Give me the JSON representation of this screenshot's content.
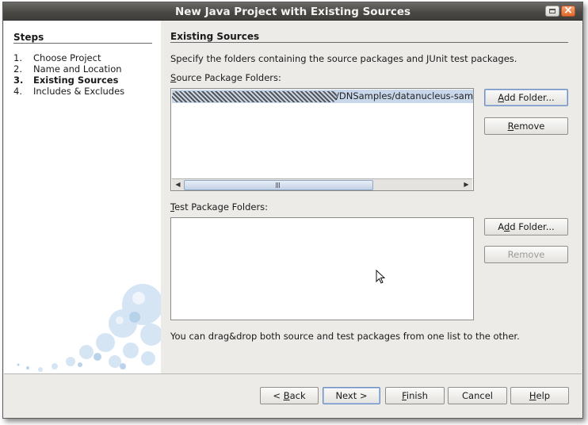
{
  "window": {
    "title": "New Java Project with Existing Sources",
    "maximize_icon": "maximize-icon",
    "close_icon": "close-icon"
  },
  "steps": {
    "title": "Steps",
    "items": [
      {
        "num": "1.",
        "label": "Choose Project",
        "active": false
      },
      {
        "num": "2.",
        "label": "Name and Location",
        "active": false
      },
      {
        "num": "3.",
        "label": "Existing Sources",
        "active": true
      },
      {
        "num": "4.",
        "label": "Includes & Excludes",
        "active": false
      }
    ]
  },
  "main": {
    "title": "Existing Sources",
    "description": "Specify the folders containing the source packages and JUnit test packages.",
    "source_label": "Source Package Folders:",
    "source_label_mnemonic": "S",
    "source_label_rest": "ource Package Folders:",
    "source_items": [
      "/DNSamples/datanucleus-samp"
    ],
    "test_label_mnemonic": "T",
    "test_label_rest": "est Package Folders:",
    "hint": "You can drag&drop both source and test packages from one list to the other."
  },
  "buttons": {
    "add_folder_src": {
      "mn": "A",
      "rest": "dd Folder..."
    },
    "remove_src": {
      "pre": "",
      "mn": "R",
      "rest": "emove"
    },
    "add_folder_test": {
      "pre": "A",
      "mn": "d",
      "rest": "d Folder..."
    },
    "remove_test": "Remove"
  },
  "footer": {
    "back": {
      "pre": "< ",
      "mn": "B",
      "rest": "ack"
    },
    "next": "Next >",
    "finish": {
      "mn": "F",
      "rest": "inish"
    },
    "cancel": "Cancel",
    "help": {
      "mn": "H",
      "rest": "elp"
    }
  },
  "colors": {
    "selection": "#c9d7ea",
    "titlebar": "#4a4945",
    "close_button": "#e06a2a"
  }
}
